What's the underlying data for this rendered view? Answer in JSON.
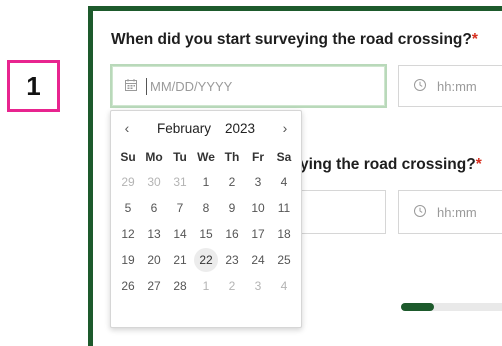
{
  "step_badge": "1",
  "question1": {
    "text": "When did you start surveying the road crossing?",
    "required_mark": "*"
  },
  "question2": {
    "visible_text": "ying the road crossing?",
    "required_mark": "*"
  },
  "date_field": {
    "placeholder": "MM/DD/YYYY",
    "icon": "calendar-icon"
  },
  "time_field": {
    "placeholder": "hh:mm",
    "icon": "clock-icon"
  },
  "calendar": {
    "month": "February",
    "year": "2023",
    "prev_icon": "‹",
    "next_icon": "›",
    "weekdays": [
      "Su",
      "Mo",
      "Tu",
      "We",
      "Th",
      "Fr",
      "Sa"
    ],
    "weeks": [
      [
        "29",
        "30",
        "31",
        "1",
        "2",
        "3",
        "4"
      ],
      [
        "5",
        "6",
        "7",
        "8",
        "9",
        "10",
        "11"
      ],
      [
        "12",
        "13",
        "14",
        "15",
        "16",
        "17",
        "18"
      ],
      [
        "19",
        "20",
        "21",
        "22",
        "23",
        "24",
        "25"
      ],
      [
        "26",
        "27",
        "28",
        "1",
        "2",
        "3",
        "4"
      ]
    ],
    "muted_cells": [
      [
        0,
        0
      ],
      [
        0,
        1
      ],
      [
        0,
        2
      ],
      [
        4,
        3
      ],
      [
        4,
        4
      ],
      [
        4,
        5
      ],
      [
        4,
        6
      ]
    ],
    "highlighted_cell": [
      3,
      3
    ]
  },
  "progress": {
    "fraction": 0.3,
    "color": "#1d5a2c"
  },
  "colors": {
    "accent": "#1d5a2c",
    "badge": "#e8248f",
    "required": "#d83020"
  }
}
